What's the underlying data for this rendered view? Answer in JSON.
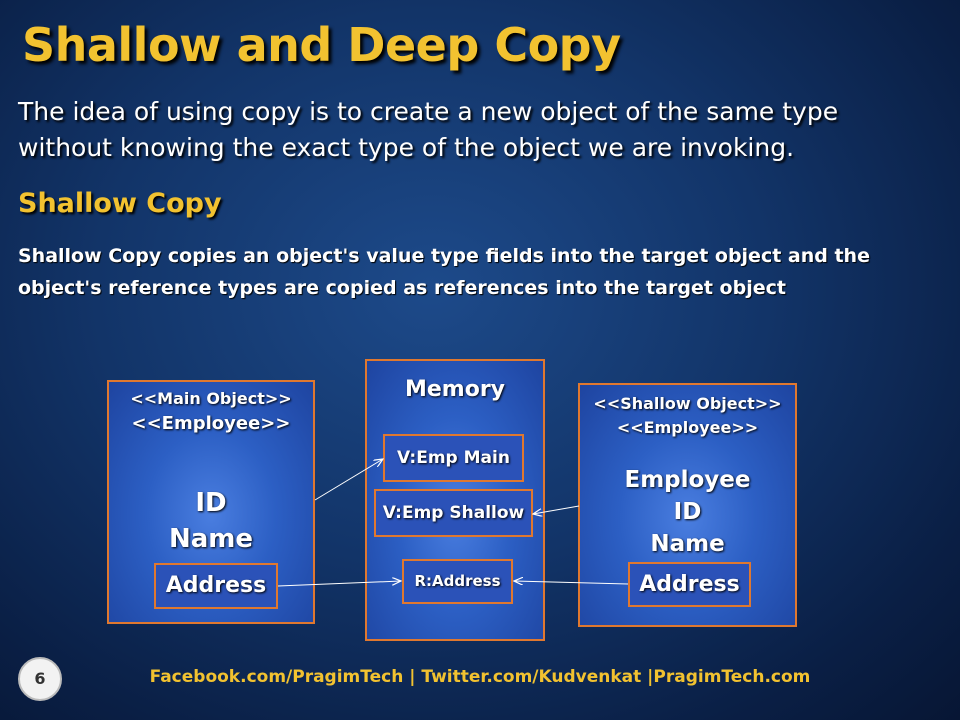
{
  "slide": {
    "title": "Shallow and Deep Copy",
    "intro": "The idea of using copy is to create a new object of the same type without knowing the exact type of the object we are invoking.",
    "subheading": "Shallow Copy",
    "description": "Shallow Copy copies an object's value type fields into the target object and the object's reference types are copied as references into the target object"
  },
  "diagram": {
    "main_object": {
      "stereotype_1": "<<Main Object>>",
      "stereotype_2": "<<Employee>>",
      "field_id": "ID",
      "field_name": "Name",
      "address": "Address"
    },
    "memory": {
      "title": "Memory",
      "emp_main": "V:Emp Main",
      "emp_shallow": "V:Emp Shallow",
      "r_address": "R:Address"
    },
    "shallow_object": {
      "stereotype_1": "<<Shallow Object>>",
      "stereotype_2": "<<Employee>>",
      "field_employee": "Employee",
      "field_id": "ID",
      "field_name": "Name",
      "address": "Address"
    }
  },
  "footer": {
    "links": "Facebook.com/PragimTech  | Twitter.com/Kudvenkat  |PragimTech.com",
    "page_number": "6"
  },
  "colors": {
    "title": "#f2c230",
    "box_border": "#e0782f",
    "box_fill": "#2c5fc4"
  }
}
